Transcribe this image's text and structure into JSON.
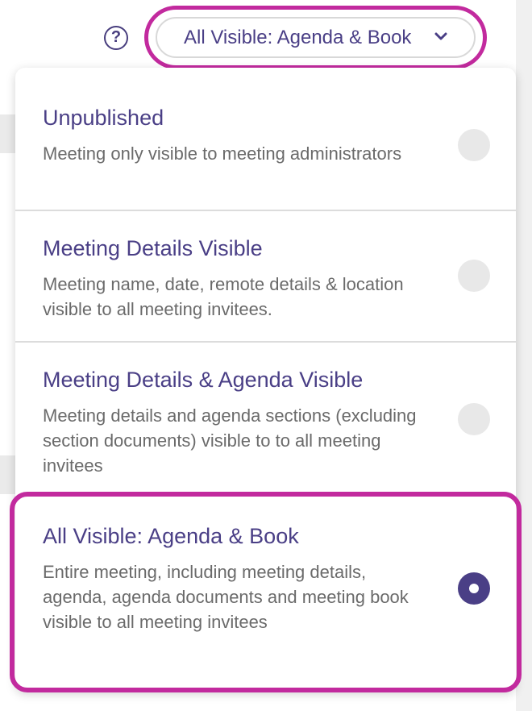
{
  "help_button": {
    "label": "?",
    "icon": "question-circle-icon"
  },
  "visibility_select": {
    "value": "All Visible: Agenda & Book",
    "icon": "chevron-down-icon"
  },
  "options": [
    {
      "title": "Unpublished",
      "description": "Meeting only visible to meeting administrators",
      "selected": false
    },
    {
      "title": "Meeting Details Visible",
      "description": "Meeting name, date, remote details & location visible to all meeting invitees.",
      "selected": false
    },
    {
      "title": "Meeting Details & Agenda Visible",
      "description": "Meeting details and agenda sections (excluding section documents) visible to to all meeting invitees",
      "selected": false
    },
    {
      "title": "All Visible: Agenda & Book",
      "description": "Entire meeting, including meeting details, agenda, agenda documents and meeting book visible to all meeting invitees",
      "selected": true
    }
  ],
  "colors": {
    "accent_ring": "#c22a9e",
    "brand_purple": "#4a3f86",
    "description_gray": "#6a6a6a",
    "radio_unselected": "#e8e8e8"
  }
}
